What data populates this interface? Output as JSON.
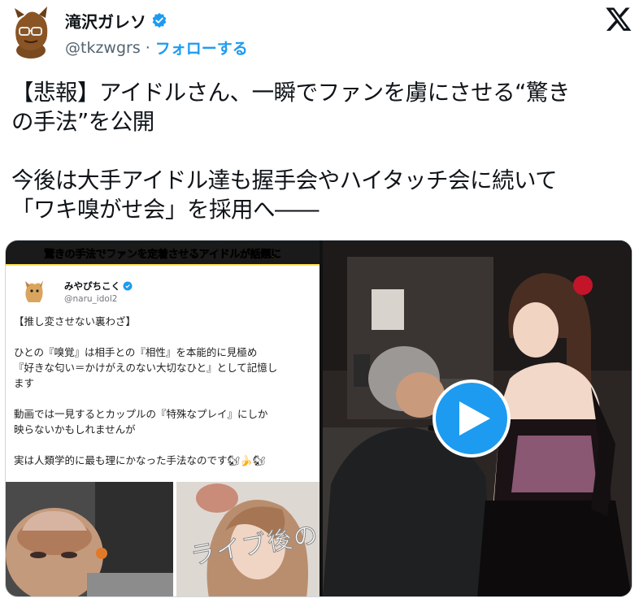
{
  "author": {
    "name": "滝沢ガレソ",
    "handle": "@tkzwgrs",
    "separator": "·",
    "follow_label": "フォローする"
  },
  "tweet": {
    "lines": [
      "【悲報】アイドルさん、一瞬でファンを虜にさせる“驚き",
      "の手法”を公開",
      "",
      "今後は大手アイドル達も握手会やハイタッチ会に続いて",
      "「ワキ嗅がせ会」を採用へ――"
    ]
  },
  "media": {
    "banner": "驚きの手法でファンを定着させるアイドルが話題に",
    "inner": {
      "name": "みやぴちこく",
      "handle": "@naru_idol2",
      "lines": [
        "【推し変させない裏わざ】",
        "",
        "ひとの『嗅覚』は相手との『相性』を本能的に見極め",
        "『好きな匂い＝かけがえのない大切なひと』として記憶し",
        "ます",
        "",
        "動画では一見するとカップルの『特殊なプレイ』にしか",
        "映らないかもしれませんが",
        "",
        "実は人類学的に最も理にかなった手法なのです🐿🍌🐿"
      ]
    },
    "photo_caption": "ライブ後の"
  },
  "colors": {
    "accent": "#1d9bf0",
    "text": "#0f1419",
    "muted": "#536471",
    "banner_text": "#ffe14d"
  },
  "icons": {
    "verified": "verified-badge-icon",
    "x_logo": "x-logo-icon",
    "play": "play-icon"
  }
}
